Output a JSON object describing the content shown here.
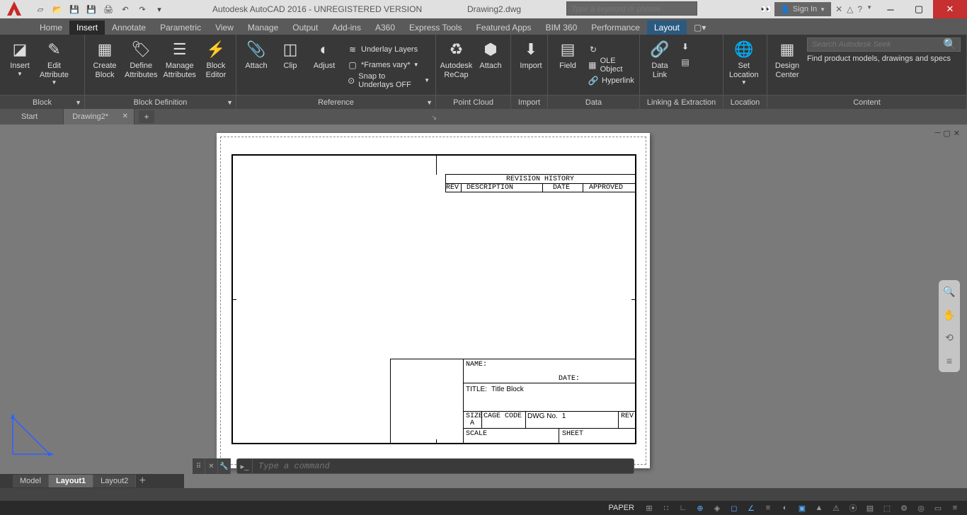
{
  "title": "Autodesk AutoCAD 2016 - UNREGISTERED VERSION",
  "filename": "Drawing2.dwg",
  "search_placeholder": "Type a keyword or phrase",
  "signin": "Sign In",
  "tabs": {
    "home": "Home",
    "insert": "Insert",
    "annotate": "Annotate",
    "parametric": "Parametric",
    "view": "View",
    "manage": "Manage",
    "output": "Output",
    "addins": "Add-ins",
    "a360": "A360",
    "express": "Express Tools",
    "featured": "Featured Apps",
    "bim360": "BIM 360",
    "performance": "Performance",
    "layout": "Layout"
  },
  "ribbon": {
    "block": {
      "insert": "Insert",
      "edit_attr": "Edit\nAttribute",
      "title": "Block"
    },
    "blockdef": {
      "create": "Create\nBlock",
      "define": "Define\nAttributes",
      "manage": "Manage\nAttributes",
      "editor": "Block\nEditor",
      "title": "Block Definition"
    },
    "reference": {
      "attach": "Attach",
      "clip": "Clip",
      "adjust": "Adjust",
      "underlay": "Underlay Layers",
      "frames": "*Frames vary*",
      "snap": "Snap to Underlays OFF",
      "title": "Reference"
    },
    "pointcloud": {
      "recap": "Autodesk\nReCap",
      "attach": "Attach",
      "title": "Point Cloud"
    },
    "import": {
      "import": "Import",
      "title": "Import"
    },
    "data": {
      "field": "Field",
      "ole": "OLE Object",
      "hyperlink": "Hyperlink",
      "title": "Data"
    },
    "linking": {
      "datalink": "Data\nLink",
      "title": "Linking & Extraction"
    },
    "location": {
      "set": "Set\nLocation",
      "title": "Location"
    },
    "content": {
      "design_center": "Design\nCenter",
      "seek_placeholder": "Search Autodesk Seek",
      "seek_text": "Find product models, drawings and specs",
      "title": "Content"
    }
  },
  "doctabs": {
    "start": "Start",
    "drawing": "Drawing2*"
  },
  "drawing": {
    "rev_history": "REVISION  HISTORY",
    "rev": "REV",
    "description": "DESCRIPTION",
    "date": "DATE",
    "approved": "APPROVED",
    "name": "NAME:",
    "date2": "DATE:",
    "title_lbl": "TITLE:",
    "title_val": "Title Block",
    "size_lbl": "SIZE",
    "size_val": "A",
    "cage": "CAGE  CODE",
    "dwg_lbl": "DWG  No.",
    "dwg_val": "1",
    "rev2": "REV",
    "scale": "SCALE",
    "sheet": "SHEET"
  },
  "cmd_placeholder": "Type a command",
  "layout_tabs": {
    "model": "Model",
    "l1": "Layout1",
    "l2": "Layout2"
  },
  "status": {
    "paper": "PAPER"
  }
}
